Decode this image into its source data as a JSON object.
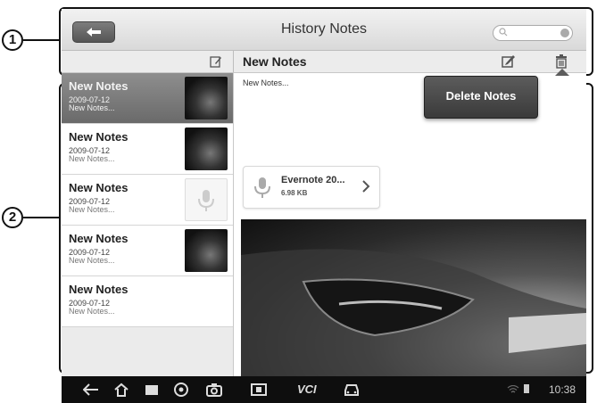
{
  "callouts": {
    "one": "1",
    "two": "2"
  },
  "header": {
    "title": "History Notes",
    "search_placeholder": ""
  },
  "toolbar": {
    "note_title": "New Notes"
  },
  "notes": [
    {
      "title": "New Notes",
      "date": "2009-07-12",
      "preview": "New Notes...",
      "thumb": "car-photo",
      "selected": true
    },
    {
      "title": "New Notes",
      "date": "2009-07-12",
      "preview": "New Notes...",
      "thumb": "car-photo",
      "selected": false
    },
    {
      "title": "New Notes",
      "date": "2009-07-12",
      "preview": "New Notes...",
      "thumb": "microphone-icon",
      "selected": false
    },
    {
      "title": "New Notes",
      "date": "2009-07-12",
      "preview": "New Notes...",
      "thumb": "car-photo",
      "selected": false
    },
    {
      "title": "New Notes",
      "date": "2009-07-12",
      "preview": "New Notes...",
      "thumb": "",
      "selected": false
    }
  ],
  "content": {
    "preview_text": "New Notes...",
    "attachment": {
      "name": "Evernote 20...",
      "size": "6.98 KB"
    }
  },
  "popup": {
    "label": "Delete Notes"
  },
  "navbar": {
    "vcl_label": "VCI",
    "time": "10:38"
  },
  "colors": {
    "accent": "#555555",
    "navbar": "#0e0e0e"
  }
}
